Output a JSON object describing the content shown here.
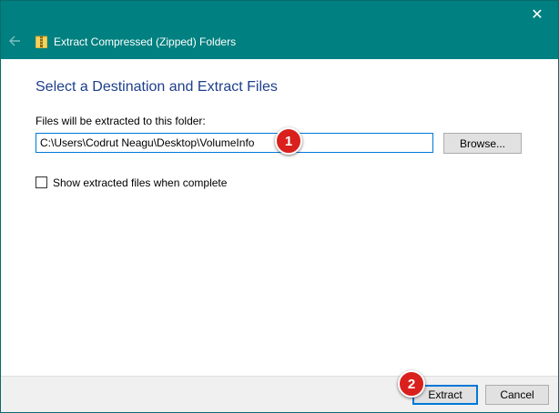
{
  "colors": {
    "titlebar": "#008080",
    "heading": "#1e3f8c",
    "focus_border": "#0078d7",
    "marker": "#d9201c"
  },
  "titlebar": {
    "back_icon": "arrow-left-icon",
    "app_icon": "zip-folder-icon",
    "title": "Extract Compressed (Zipped) Folders",
    "close_icon": "close-icon",
    "close_glyph": "✕"
  },
  "main": {
    "heading": "Select a Destination and Extract Files",
    "folder_label": "Files will be extracted to this folder:",
    "path_value": "C:\\Users\\Codrut Neagu\\Desktop\\VolumeInfo",
    "browse_label": "Browse...",
    "show_files_label": "Show extracted files when complete",
    "show_files_checked": false
  },
  "footer": {
    "extract_label": "Extract",
    "cancel_label": "Cancel"
  },
  "annotations": [
    {
      "label": "1"
    },
    {
      "label": "2"
    }
  ]
}
